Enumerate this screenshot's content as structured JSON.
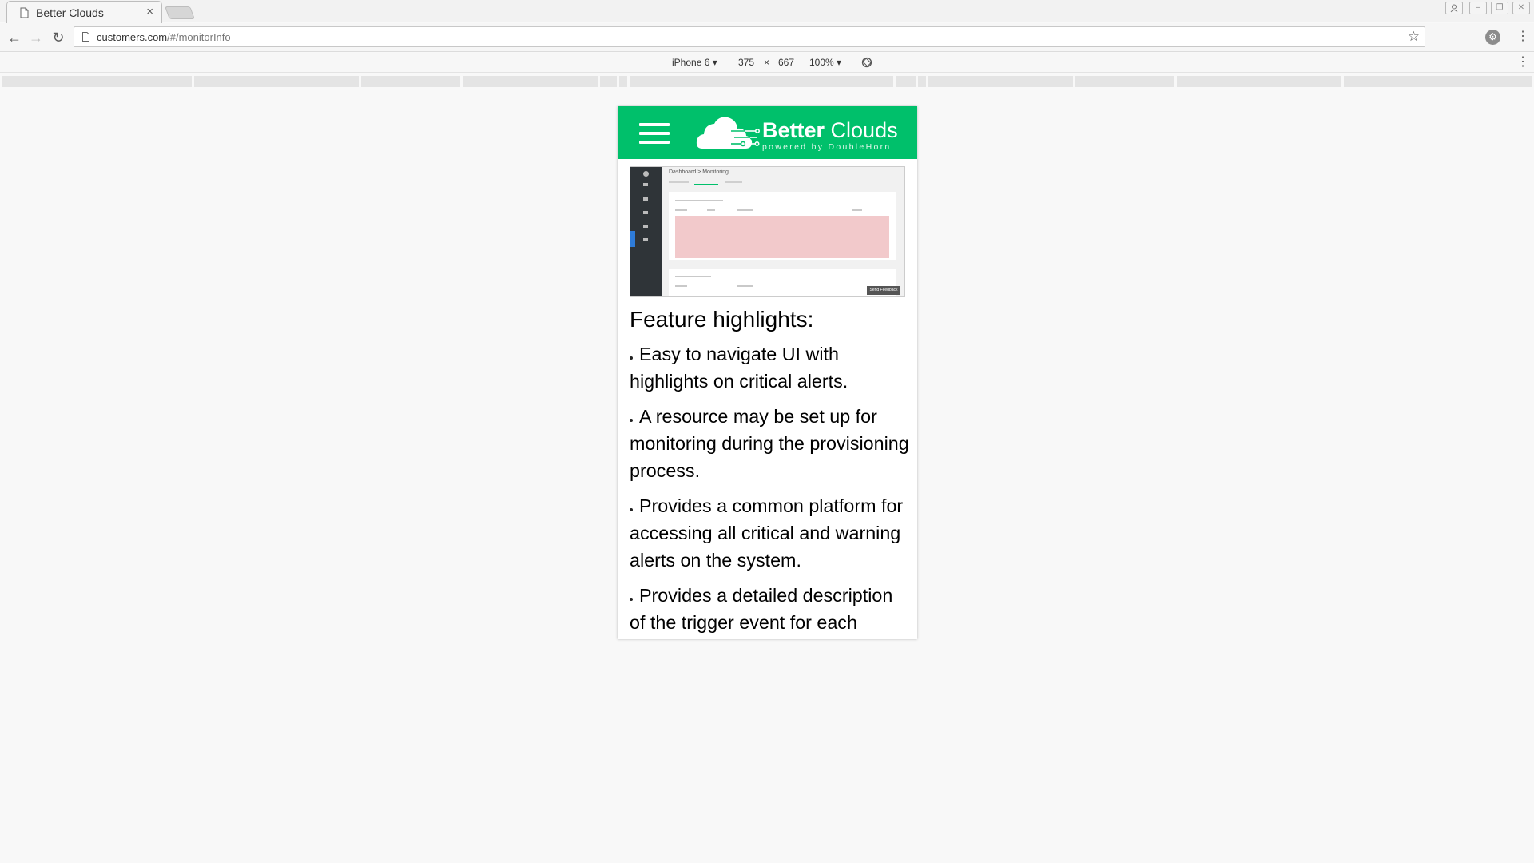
{
  "browser": {
    "tab": {
      "title": "Better Clouds"
    },
    "address": {
      "host": "customers.com",
      "path": "/#/monitorInfo"
    }
  },
  "devtools": {
    "device": "iPhone 6 ▾",
    "width": "375",
    "times": "×",
    "height": "667",
    "zoom": "100% ▾"
  },
  "app": {
    "colors": {
      "header": "#00c06b"
    },
    "logo": {
      "bold": "Better",
      "light": "Clouds",
      "tagline": "powered by DoubleHorn"
    },
    "screenshot": {
      "breadcrumb": "Dashboard > Monitoring",
      "feedback": "Send Feedback"
    },
    "section_title": "Feature highlights:",
    "features": [
      "Easy to navigate UI with highlights on critical alerts.",
      "A resource may be set up for monitoring during the provisioning process.",
      "Provides a common platform for accessing all critical and warning alerts on the system.",
      "Provides a detailed description of the trigger event for each"
    ]
  }
}
